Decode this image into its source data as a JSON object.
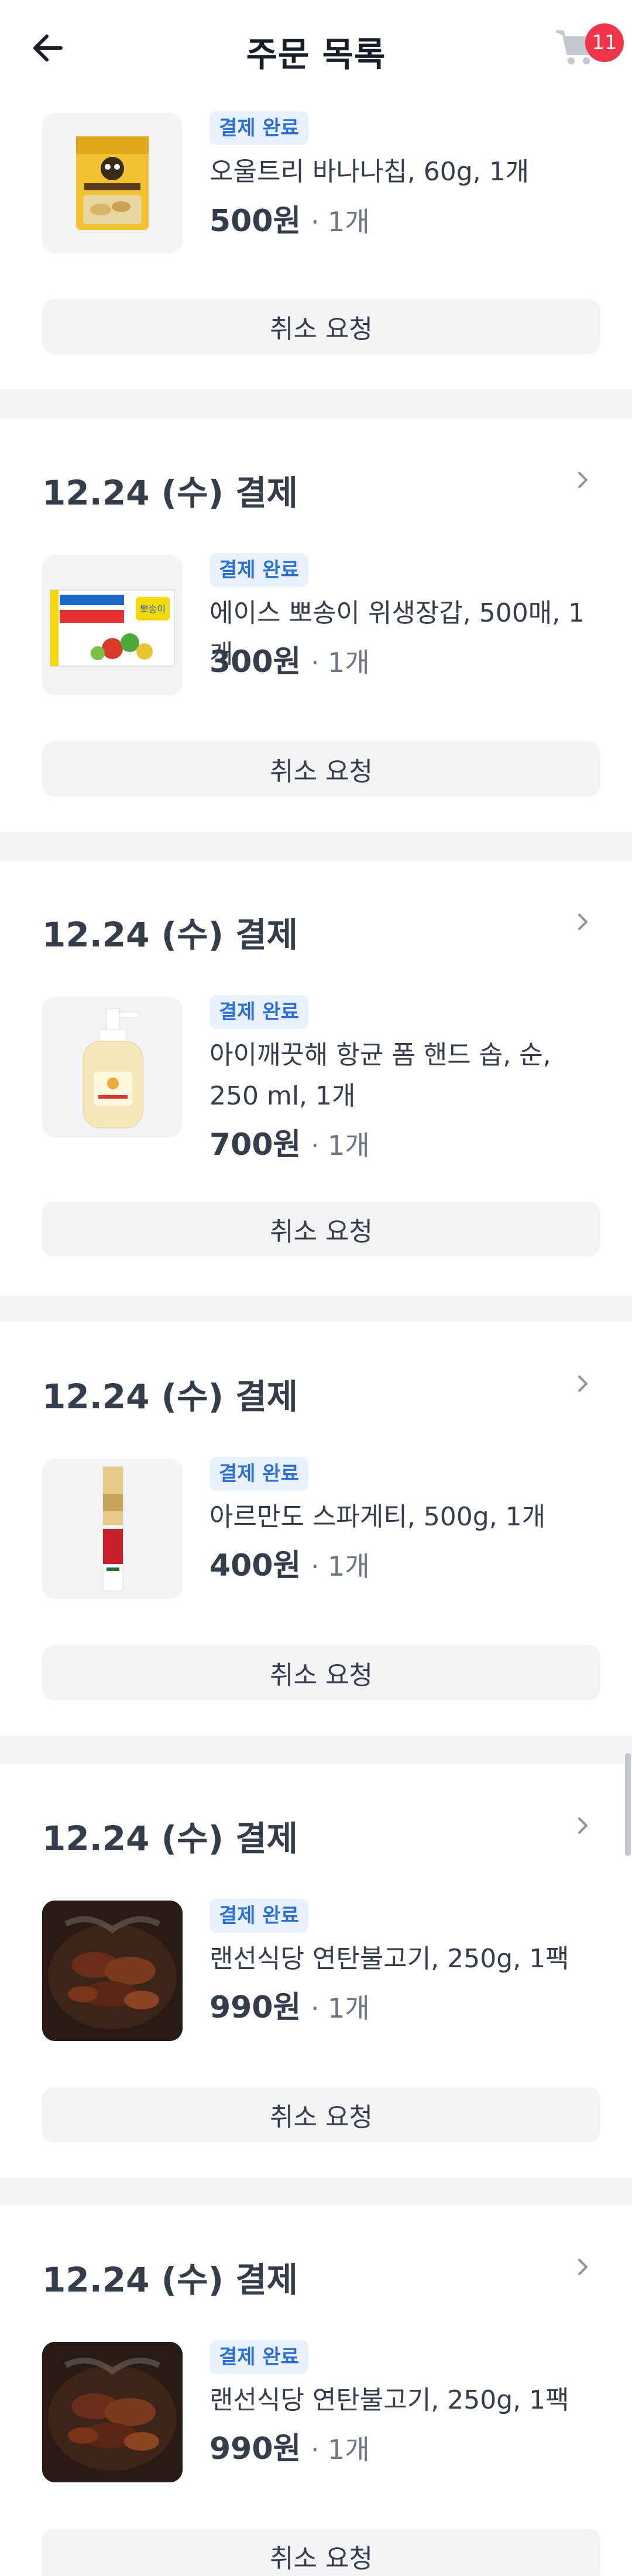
{
  "header": {
    "title": "주문 목록",
    "cart_count": "11"
  },
  "orders": [
    {
      "date": "",
      "status": "결제 완료",
      "name": "오울트리 바나나칩, 60g, 1개",
      "price": "500원",
      "qty": "· 1개",
      "cancel": "취소 요청",
      "thumb": "banana-chips"
    },
    {
      "date": "12.24 (수) 결제",
      "status": "결제 완료",
      "name": "에이스 뽀송이 위생장갑, 500매, 1개",
      "price": "300원",
      "qty": "· 1개",
      "cancel": "취소 요청",
      "thumb": "gloves"
    },
    {
      "date": "12.24 (수) 결제",
      "status": "결제 완료",
      "name": "아이깨끗해 항균 폼 핸드 솝, 순, 250 ml, 1개",
      "price": "700원",
      "qty": "· 1개",
      "cancel": "취소 요청",
      "thumb": "hand-soap"
    },
    {
      "date": "12.24 (수) 결제",
      "status": "결제 완료",
      "name": "아르만도 스파게티, 500g, 1개",
      "price": "400원",
      "qty": "· 1개",
      "cancel": "취소 요청",
      "thumb": "spaghetti"
    },
    {
      "date": "12.24 (수) 결제",
      "status": "결제 완료",
      "name": "랜선식당 연탄불고기, 250g, 1팩",
      "price": "990원",
      "qty": "· 1개",
      "cancel": "취소 요청",
      "thumb": "bulgogi"
    },
    {
      "date": "12.24 (수) 결제",
      "status": "결제 완료",
      "name": "랜선식당 연탄불고기, 250g, 1팩",
      "price": "990원",
      "qty": "· 1개",
      "cancel": "취소 요청",
      "thumb": "bulgogi"
    }
  ],
  "colors": {
    "accent": "#2b6fd6",
    "badge_bg": "#e8f1fd",
    "cart_badge": "#f0354a",
    "divider": "#f2f4f6"
  }
}
